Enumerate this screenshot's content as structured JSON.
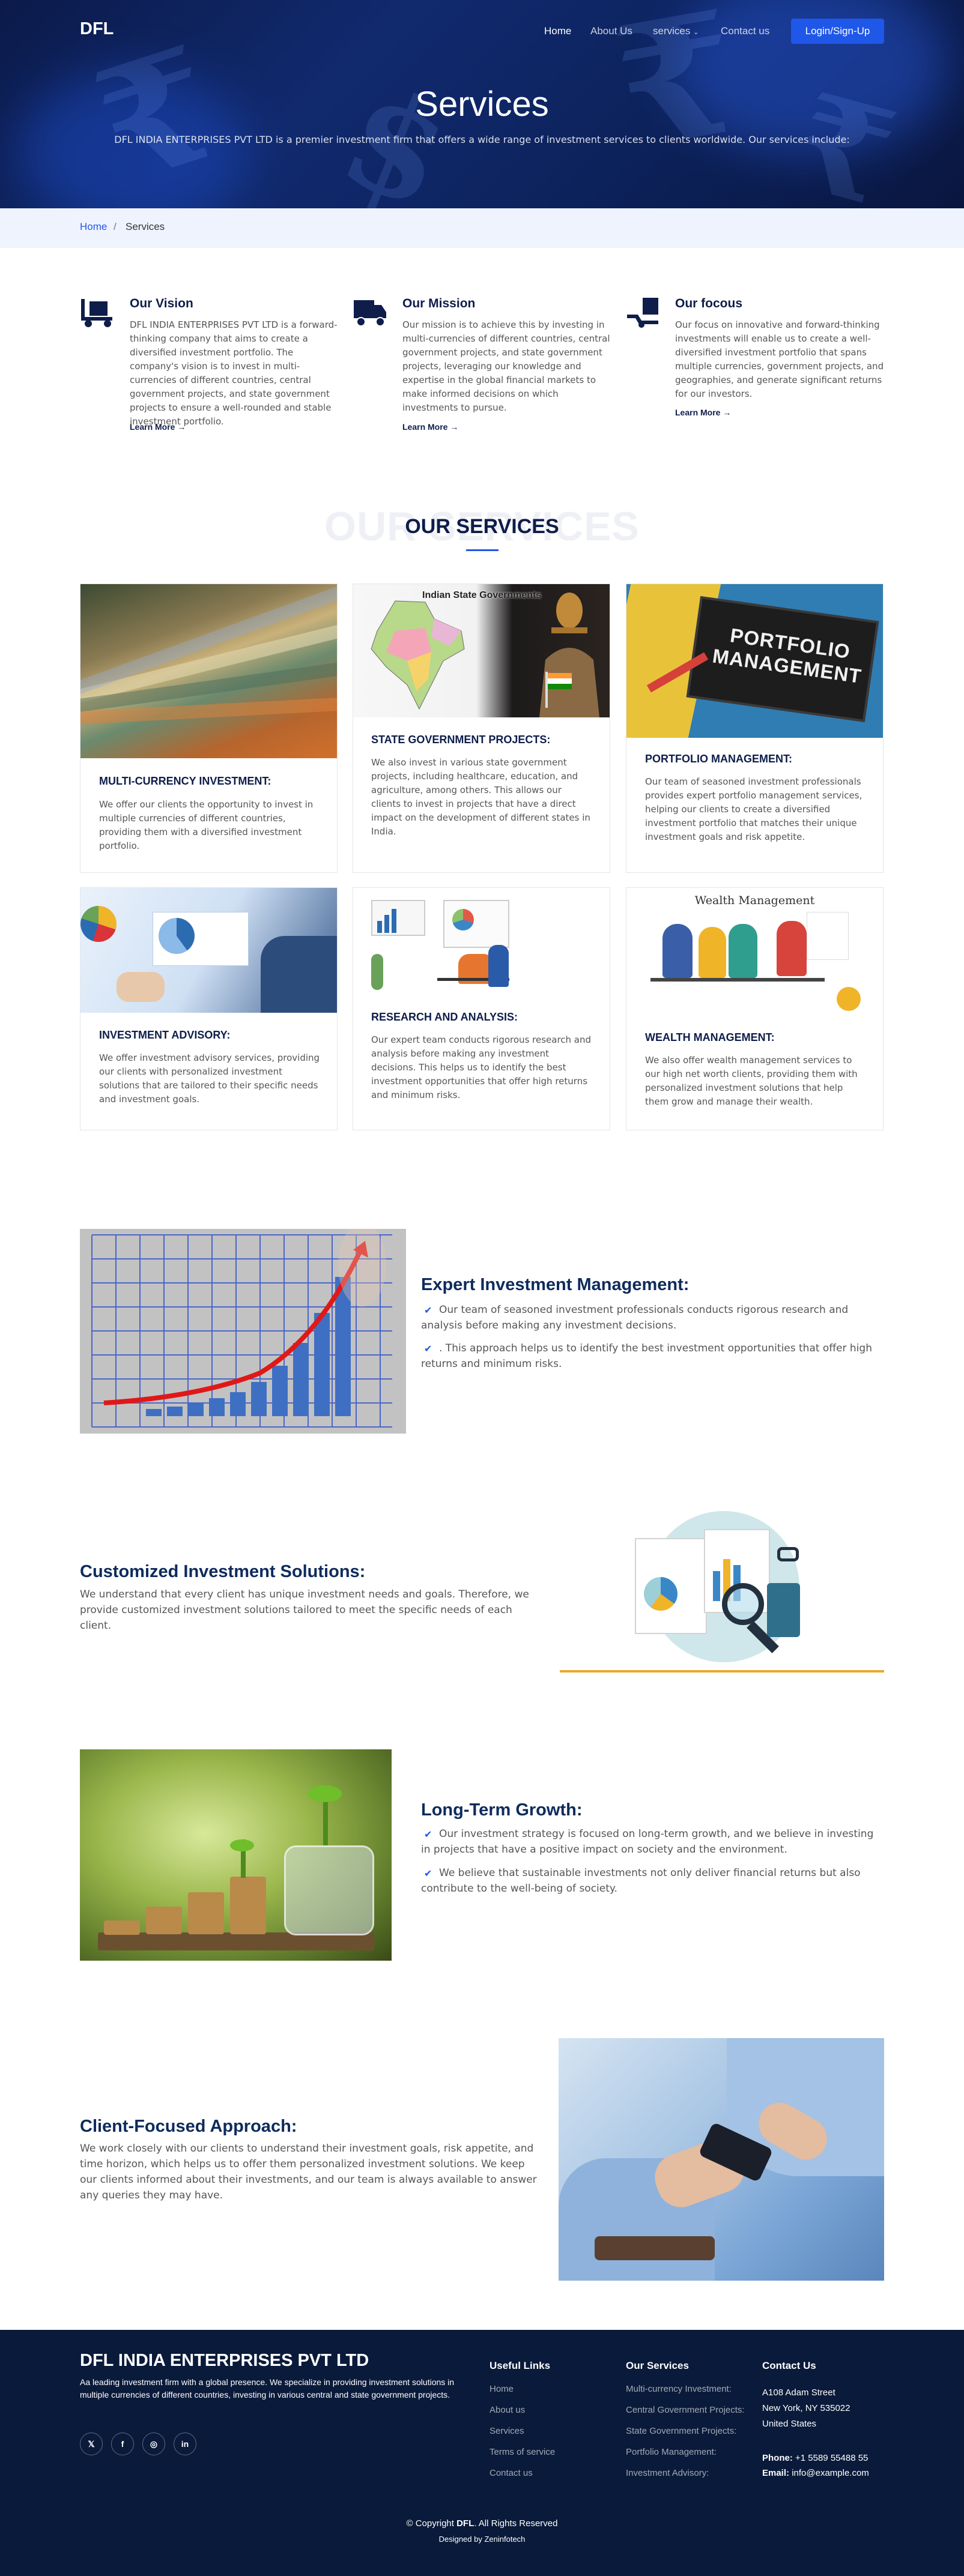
{
  "header": {
    "logo": "DFL",
    "nav": [
      {
        "label": "Home",
        "active": true
      },
      {
        "label": "About Us"
      },
      {
        "label": "services"
      },
      {
        "label": "Contact us"
      }
    ],
    "login_label": "Login/Sign-Up"
  },
  "hero": {
    "title": "Services",
    "subtitle": "DFL INDIA ENTERPRISES PVT LTD is a premier investment firm that offers a wide range of investment services to clients worldwide. Our services include:"
  },
  "breadcrumb": {
    "home": "Home",
    "separator": "/",
    "current": "Services"
  },
  "features": [
    {
      "icon": "hand-truck-icon",
      "title": "Our Vision",
      "text": "DFL INDIA ENTERPRISES PVT LTD is a forward-thinking company that aims to create a diversified investment portfolio. The company's vision is to invest in multi-currencies of different countries, central government projects, and state government projects to ensure a well-rounded and stable investment portfolio.",
      "link": "Learn More"
    },
    {
      "icon": "truck-icon",
      "title": "Our Mission",
      "text": "Our mission is to achieve this by investing in multi-currencies of different countries, central government projects, and state government projects, leveraging our knowledge and expertise in the global financial markets to make informed decisions on which investments to pursue.",
      "link": "Learn More"
    },
    {
      "icon": "hand-truck-box-icon",
      "title": "Our focous",
      "text": "Our focus on innovative and forward-thinking investments will enable us to create a well-diversified investment portfolio that spans multiple currencies, government projects, and geographies, and generate significant returns for our investors.",
      "link": "Learn More"
    }
  ],
  "services_section": {
    "ghost": "OUR SERVICES",
    "title": "OUR SERVICES"
  },
  "services": [
    {
      "title": "MULTI-CURRENCY INVESTMENT:",
      "text": "We offer our clients the opportunity to invest in multiple currencies of different countries, providing them with a diversified investment portfolio."
    },
    {
      "title": "STATE GOVERNMENT PROJECTS:",
      "text": "We also invest in various state government projects, including healthcare, education, and agriculture, among others. This allows our clients to invest in projects that have a direct impact on the development of different states in India.",
      "img_caption": "Indian State Governments"
    },
    {
      "title": "PORTFOLIO MANAGEMENT:",
      "text": "Our team of seasoned investment professionals provides expert portfolio management services, helping our clients to create a diversified investment portfolio that matches their unique investment goals and risk appetite.",
      "img_caption": "PORTFOLIO MANAGEMENT"
    },
    {
      "title": "INVESTMENT ADVISORY:",
      "text": "We offer investment advisory services, providing our clients with personalized investment solutions that are tailored to their specific needs and investment goals."
    },
    {
      "title": "RESEARCH AND ANALYSIS:",
      "text": "Our expert team conducts rigorous research and analysis before making any investment decisions. This helps us to identify the best investment opportunities that offer high returns and minimum risks."
    },
    {
      "title": "WEALTH MANAGEMENT:",
      "text": "We also offer wealth management services to our high net worth clients, providing them with personalized investment solutions that help them grow and manage their wealth.",
      "img_caption": "Wealth Management"
    }
  ],
  "rows": {
    "expert": {
      "title": "Expert Investment Management:",
      "points": [
        "Our team of seasoned investment professionals conducts rigorous research and analysis before making any investment decisions.",
        ". This approach helps us to identify the best investment opportunities that offer high returns and minimum risks."
      ]
    },
    "customized": {
      "title": "Customized Investment Solutions:",
      "text": "We understand that every client has unique investment needs and goals. Therefore, we provide customized investment solutions tailored to meet the specific needs of each client."
    },
    "longterm": {
      "title": "Long-Term Growth:",
      "points": [
        "Our investment strategy is focused on long-term growth, and we believe in investing in projects that have a positive impact on society and the environment.",
        "We believe that sustainable investments not only deliver financial returns but also contribute to the well-being of society."
      ]
    },
    "client": {
      "title": "Client-Focused Approach:",
      "text": "We work closely with our clients to understand their investment goals, risk appetite, and time horizon, which helps us to offer them personalized investment solutions. We keep our clients informed about their investments, and our team is always available to answer any queries they may have."
    }
  },
  "footer": {
    "company": "DFL INDIA ENTERPRISES PVT LTD",
    "about": "Aa leading investment firm with a global presence. We specialize in providing investment solutions in multiple currencies of different countries, investing in various central and state government projects.",
    "social": [
      "twitter-icon",
      "facebook-icon",
      "instagram-icon",
      "linkedin-icon"
    ],
    "useful_title": "Useful Links",
    "useful": [
      "Home",
      "About us",
      "Services",
      "Terms of service",
      "Contact us"
    ],
    "services_title": "Our Services",
    "services": [
      "Multi-currency Investment:",
      "Central Government Projects:",
      "State Government Projects:",
      "Portfolio Management:",
      "Investment Advisory:"
    ],
    "contact_title": "Contact Us",
    "address": [
      "A108 Adam Street",
      "New York, NY 535022",
      "United States"
    ],
    "phone_label": "Phone:",
    "phone": "+1 5589 55488 55",
    "email_label": "Email:",
    "email": "info@example.com",
    "copyright_pre": "© Copyright",
    "copyright_brand": "DFL",
    "copyright_post": ". All Rights Reserved",
    "designed": "Designed by Zeninfotech"
  },
  "colors": {
    "navy": "#0e1d4a",
    "accent": "#1f57e8",
    "footer": "#0a1a3a",
    "gold": "#e9a82b"
  }
}
